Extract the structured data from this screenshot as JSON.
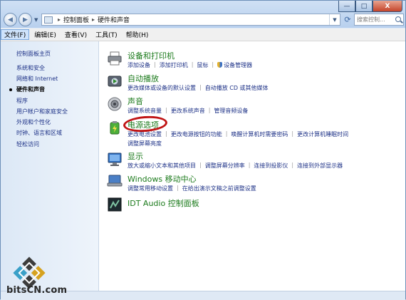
{
  "window": {
    "address": {
      "root": "控制面板",
      "current": "硬件和声音"
    },
    "search_placeholder": "搜索控制...",
    "caption": {
      "minimize": "—",
      "maximize": "□",
      "close": "X"
    }
  },
  "menubar": {
    "file": "文件(F)",
    "edit": "编辑(E)",
    "view": "查看(V)",
    "tools": "工具(T)",
    "help": "帮助(H)"
  },
  "sidebar": {
    "items": [
      "控制面板主页",
      "系统和安全",
      "网络和 Internet",
      "硬件和声音",
      "程序",
      "用户帐户和家庭安全",
      "外观和个性化",
      "时钟、语言和区域",
      "轻松访问"
    ],
    "current_index": 3
  },
  "categories": {
    "devices": {
      "title": "设备和打印机",
      "links": [
        "添加设备",
        "添加打印机",
        "鼠标",
        "设备管理器"
      ]
    },
    "autoplay": {
      "title": "自动播放",
      "links": [
        "更改媒体或设备的默认设置",
        "自动播放 CD 或其他媒体"
      ]
    },
    "sound": {
      "title": "声音",
      "links": [
        "调整系统音量",
        "更改系统声音",
        "管理音频设备"
      ]
    },
    "power": {
      "title": "电源选项",
      "links": [
        "更改电池设置",
        "更改电源按钮的功能",
        "唤醒计算机时需要密码",
        "更改计算机睡眠时间"
      ],
      "links2": [
        "调整屏幕亮度"
      ]
    },
    "display": {
      "title": "显示",
      "links": [
        "放大或缩小文本和其他项目",
        "调整屏幕分辨率",
        "连接到投影仪",
        "连接到外部显示器"
      ]
    },
    "mobility": {
      "title": "Windows 移动中心",
      "links": [
        "调整常用移动设置",
        "在给出演示文稿之前调整设置"
      ]
    },
    "idt": {
      "title": "IDT Audio 控制面板"
    }
  },
  "watermark": {
    "text": "bitsCN.com"
  },
  "colors": {
    "link": "#1e3287",
    "category_title": "#1b7a1b",
    "highlight_ring": "#c01414"
  }
}
